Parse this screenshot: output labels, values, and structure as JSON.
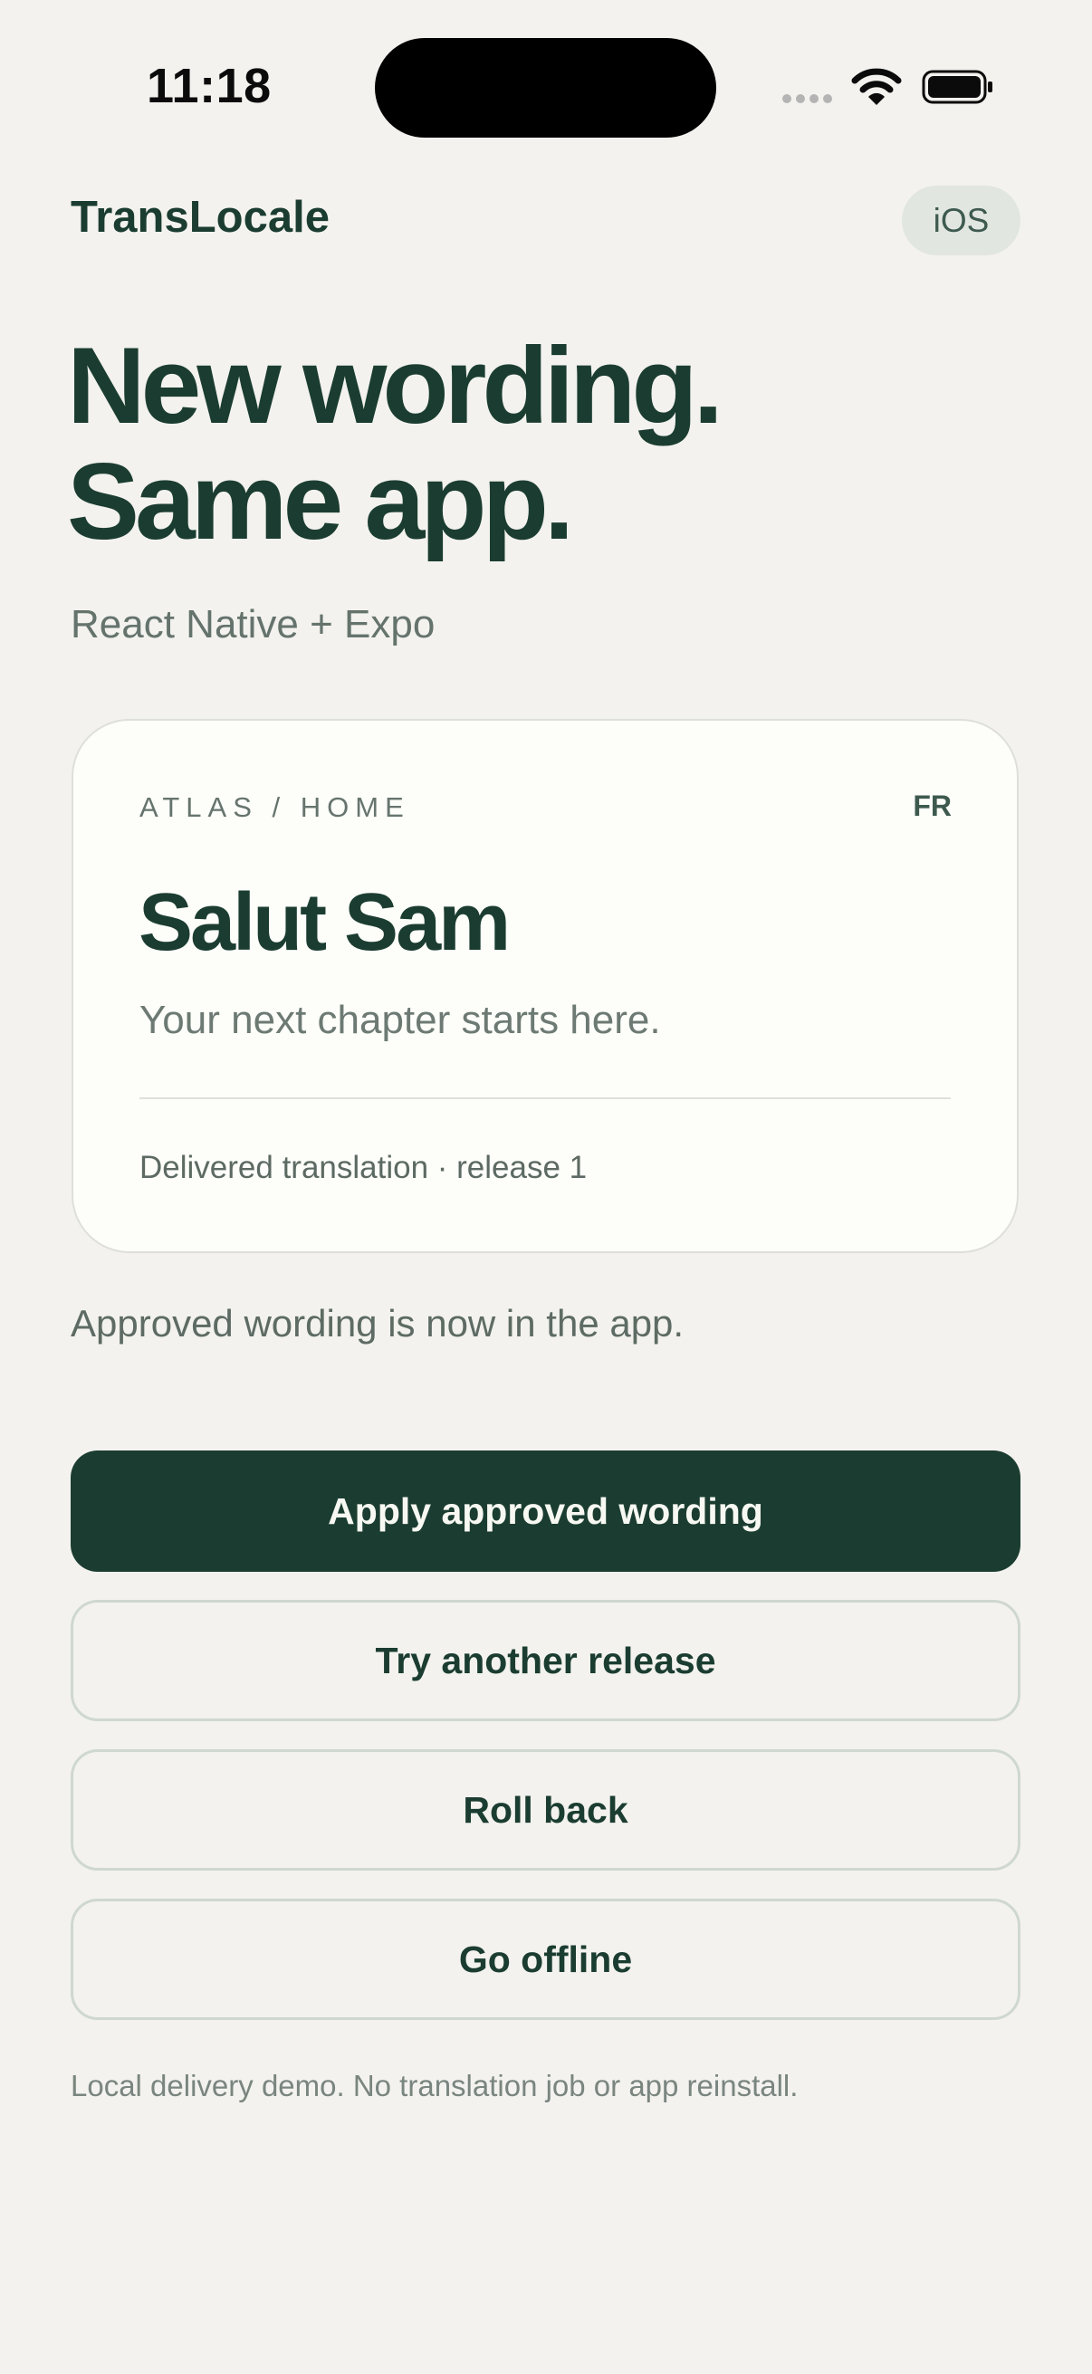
{
  "status_bar": {
    "time": "11:18",
    "icons": [
      "cellular-signal-icon",
      "wifi-icon",
      "battery-icon"
    ]
  },
  "header": {
    "brand": "TransLocale",
    "platform_chip": "iOS"
  },
  "hero": {
    "line1": "New wording.",
    "line2": "Same app.",
    "subtitle": "React Native + Expo"
  },
  "preview_card": {
    "path": "ATLAS / HOME",
    "language": "FR",
    "greeting": "Salut Sam",
    "tagline": "Your next chapter starts here.",
    "meta": "Delivered translation · release 1"
  },
  "status_message": "Approved wording is now in the app.",
  "actions": {
    "apply": "Apply approved wording",
    "try_release": "Try another release",
    "roll_back": "Roll back",
    "go_offline": "Go offline"
  },
  "footnote": "Local delivery demo. No translation job or app reinstall.",
  "colors": {
    "background": "#f3f2ee",
    "primary": "#1b3d31",
    "card_background": "#fdfdf9",
    "chip_background": "#e1e6e1",
    "muted_text": "#65736d"
  }
}
